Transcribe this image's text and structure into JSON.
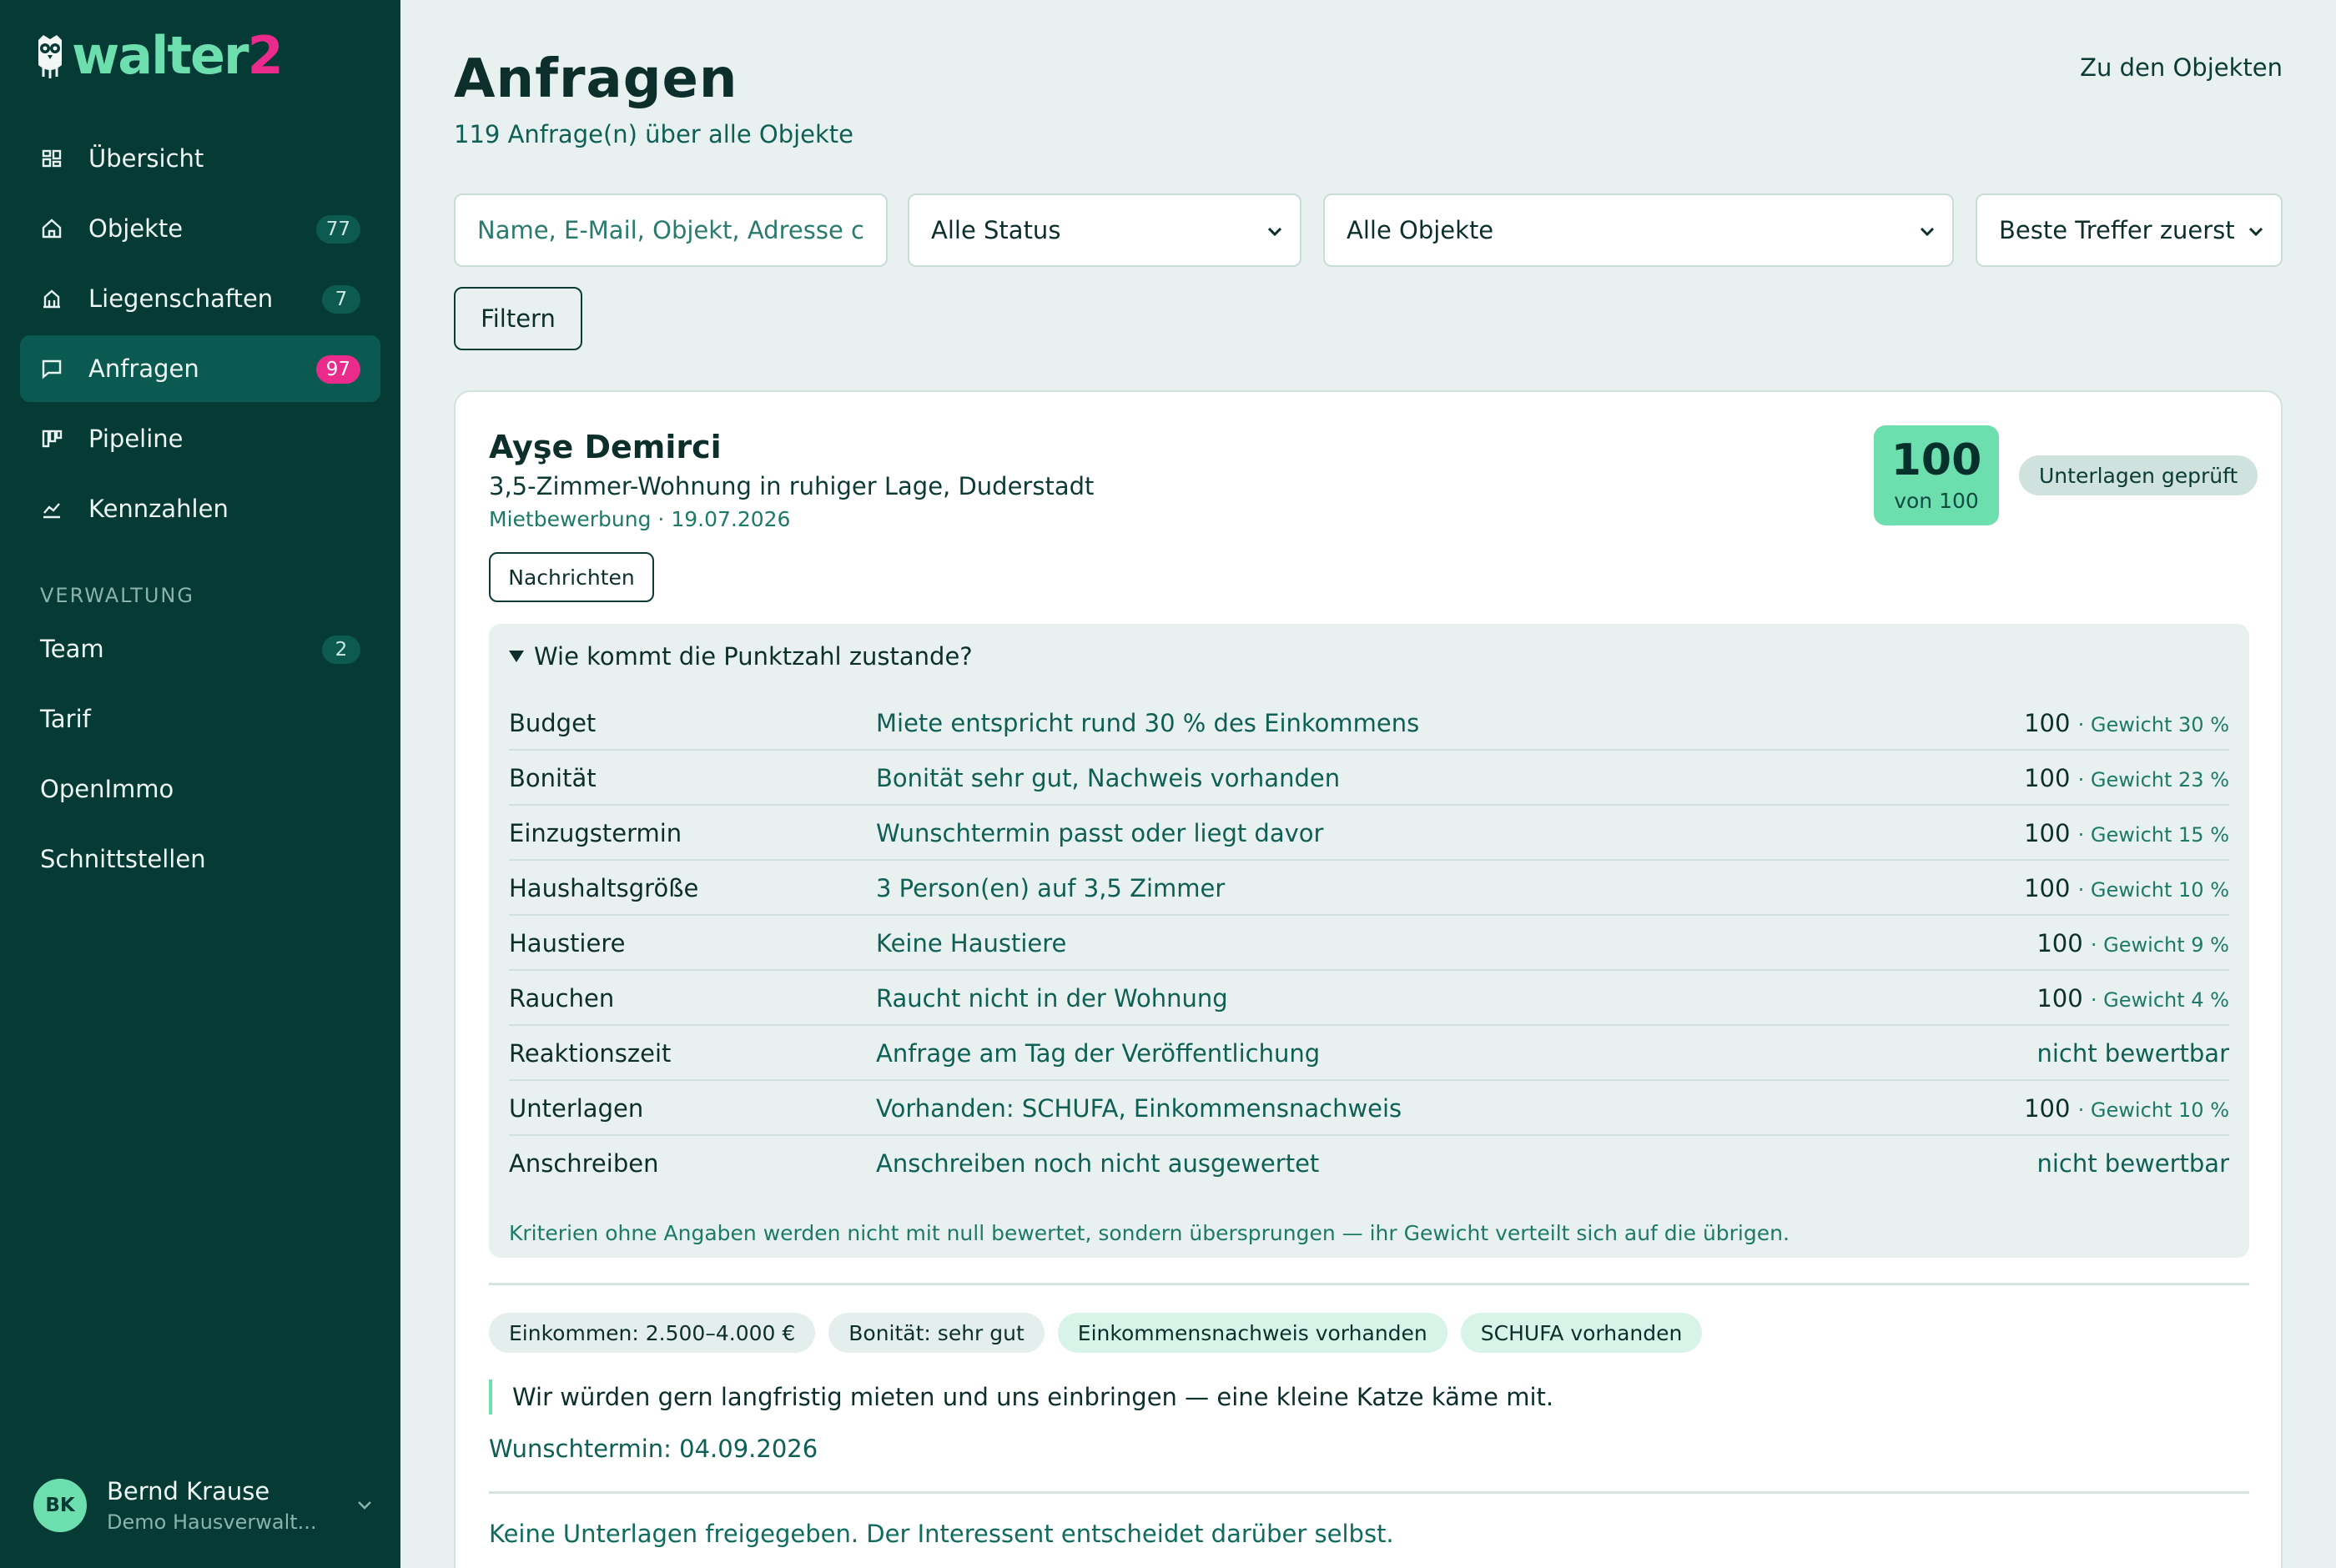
{
  "brand": {
    "name_part1": "walter",
    "name_part2": "2"
  },
  "sidebar": {
    "items": [
      {
        "label": "Übersicht",
        "icon": "dashboard-icon",
        "badge": ""
      },
      {
        "label": "Objekte",
        "icon": "home-icon",
        "badge": "77"
      },
      {
        "label": "Liegenschaften",
        "icon": "building-icon",
        "badge": "7"
      },
      {
        "label": "Anfragen",
        "icon": "chat-icon",
        "badge": "97",
        "active": true
      },
      {
        "label": "Pipeline",
        "icon": "kanban-icon",
        "badge": ""
      },
      {
        "label": "Kennzahlen",
        "icon": "chart-icon",
        "badge": ""
      }
    ],
    "section_label": "VERWALTUNG",
    "admin_items": [
      {
        "label": "Team",
        "badge": "2"
      },
      {
        "label": "Tarif"
      },
      {
        "label": "OpenImmo"
      },
      {
        "label": "Schnittstellen"
      }
    ],
    "user": {
      "initials": "BK",
      "name": "Bernd Krause",
      "org": "Demo Hausverwalt..."
    }
  },
  "header": {
    "title": "Anfragen",
    "subtitle": "119 Anfrage(n) über alle Objekte",
    "link": "Zu den Objekten"
  },
  "filters": {
    "search_placeholder": "Name, E-Mail, Objekt, Adresse c",
    "status": "Alle Status",
    "objects": "Alle Objekte",
    "sort": "Beste Treffer zuerst",
    "filter_button": "Filtern"
  },
  "card": {
    "name": "Ayşe Demirci",
    "object": "3,5-Zimmer-Wohnung in ruhiger Lage, Duderstadt",
    "meta": "Mietbewerbung · 19.07.2026",
    "messages_button": "Nachrichten",
    "score": "100",
    "score_of": "von 100",
    "status": "Unterlagen geprüft",
    "breakdown_title": "Wie kommt die Punktzahl zustande?",
    "rows": [
      {
        "criterion": "Budget",
        "description": "Miete entspricht rund 30 % des Einkommens",
        "score": "100",
        "weight": "· Gewicht 30 %",
        "na": ""
      },
      {
        "criterion": "Bonität",
        "description": "Bonität sehr gut, Nachweis vorhanden",
        "score": "100",
        "weight": "· Gewicht 23 %",
        "na": ""
      },
      {
        "criterion": "Einzugstermin",
        "description": "Wunschtermin passt oder liegt davor",
        "score": "100",
        "weight": "· Gewicht 15 %",
        "na": ""
      },
      {
        "criterion": "Haushaltsgröße",
        "description": "3 Person(en) auf 3,5 Zimmer",
        "score": "100",
        "weight": "· Gewicht 10 %",
        "na": ""
      },
      {
        "criterion": "Haustiere",
        "description": "Keine Haustiere",
        "score": "100",
        "weight": "· Gewicht 9 %",
        "na": ""
      },
      {
        "criterion": "Rauchen",
        "description": "Raucht nicht in der Wohnung",
        "score": "100",
        "weight": "· Gewicht 4 %",
        "na": ""
      },
      {
        "criterion": "Reaktionszeit",
        "description": "Anfrage am Tag der Veröffentlichung",
        "score": "",
        "weight": "",
        "na": "nicht bewertbar"
      },
      {
        "criterion": "Unterlagen",
        "description": "Vorhanden: SCHUFA, Einkommensnachweis",
        "score": "100",
        "weight": "· Gewicht 10 %",
        "na": ""
      },
      {
        "criterion": "Anschreiben",
        "description": "Anschreiben noch nicht ausgewertet",
        "score": "",
        "weight": "",
        "na": "nicht bewertbar"
      }
    ],
    "breakdown_note": "Kriterien ohne Angaben werden nicht mit null bewertet, sondern übersprungen — ihr Gewicht verteilt sich auf die übrigen.",
    "chips": [
      {
        "label": "Einkommen: 2.500–4.000 €",
        "style": "grey"
      },
      {
        "label": "Bonität: sehr gut",
        "style": "grey"
      },
      {
        "label": "Einkommensnachweis vorhanden",
        "style": "green"
      },
      {
        "label": "SCHUFA vorhanden",
        "style": "green"
      }
    ],
    "quote": "Wir würden gern langfristig mieten und uns einbringen — eine kleine Katze käme mit.",
    "wish_date": "Wunschtermin: 04.09.2026",
    "docs_note": "Keine Unterlagen freigegeben. Der Interessent entscheidet darüber selbst."
  },
  "colors": {
    "sidebar": "#063a35",
    "accent": "#6ddfae",
    "pink": "#ea2b8c",
    "background": "#e9f1f0"
  }
}
